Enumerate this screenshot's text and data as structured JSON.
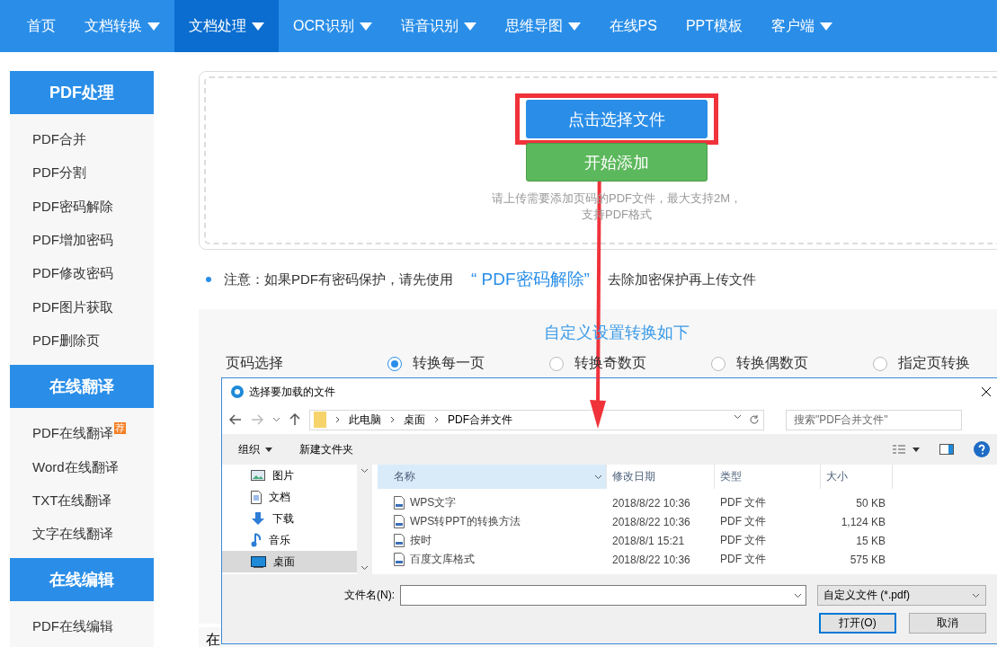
{
  "nav": [
    {
      "label": "首页",
      "dropdown": false,
      "selected": false
    },
    {
      "label": "文档转换",
      "dropdown": true,
      "selected": false
    },
    {
      "label": "文档处理",
      "dropdown": true,
      "selected": true
    },
    {
      "label": "OCR识别",
      "dropdown": true,
      "selected": false
    },
    {
      "label": "语音识别",
      "dropdown": true,
      "selected": false
    },
    {
      "label": "思维导图",
      "dropdown": true,
      "selected": false
    },
    {
      "label": "在线PS",
      "dropdown": false,
      "selected": false
    },
    {
      "label": "PPT模板",
      "dropdown": false,
      "selected": false
    },
    {
      "label": "客户端",
      "dropdown": true,
      "selected": false
    }
  ],
  "sidebar": {
    "groups": [
      {
        "title": "PDF处理",
        "items": [
          {
            "label": "PDF合并"
          },
          {
            "label": "PDF分割"
          },
          {
            "label": "PDF密码解除"
          },
          {
            "label": "PDF增加密码"
          },
          {
            "label": "PDF修改密码"
          },
          {
            "label": "PDF图片获取"
          },
          {
            "label": "PDF删除页"
          }
        ]
      },
      {
        "title": "在线翻译",
        "items": [
          {
            "label": "PDF在线翻译",
            "badge": "荐"
          },
          {
            "label": "Word在线翻译"
          },
          {
            "label": "TXT在线翻译"
          },
          {
            "label": "文字在线翻译"
          }
        ]
      },
      {
        "title": "在线编辑",
        "items": [
          {
            "label": "PDF在线编辑"
          }
        ]
      }
    ]
  },
  "upload": {
    "select_button": "点击选择文件",
    "start_button": "开始添加",
    "hint_lines": [
      "请上传需要添加页码的PDF文件，最大支持2M，",
      "支持PDF格式"
    ]
  },
  "note": {
    "prefix": "注意：如果PDF有密码保护，请先使用",
    "link": "“ PDF密码解除”",
    "suffix": "去除加密保护再上传文件"
  },
  "settings": {
    "title": "自定义设置转换如下",
    "label": "页码选择",
    "options": [
      {
        "label": "转换每一页",
        "selected": true
      },
      {
        "label": "转换奇数页",
        "selected": false
      },
      {
        "label": "转换偶数页",
        "selected": false
      },
      {
        "label": "指定页转换",
        "selected": false
      }
    ]
  },
  "bottom_text": "在",
  "dialog": {
    "title": "选择要加载的文件",
    "breadcrumb": [
      "此电脑",
      "桌面",
      "PDF合并文件"
    ],
    "search_placeholder": "搜索\"PDF合并文件\"",
    "toolbar": {
      "organize": "组织",
      "new_folder": "新建文件夹"
    },
    "nav_items": [
      {
        "label": "图片",
        "selected": false
      },
      {
        "label": "文档",
        "selected": false
      },
      {
        "label": "下载",
        "selected": false
      },
      {
        "label": "音乐",
        "selected": false
      },
      {
        "label": "桌面",
        "selected": true
      }
    ],
    "columns": [
      "名称",
      "修改日期",
      "类型",
      "大小"
    ],
    "files": [
      {
        "name": "WPS文字",
        "date": "2018/8/22 10:36",
        "type": "PDF 文件",
        "size": "50 KB"
      },
      {
        "name": "WPS转PPT的转换方法",
        "date": "2018/8/22 10:36",
        "type": "PDF 文件",
        "size": "1,124 KB"
      },
      {
        "name": "按时",
        "date": "2018/8/1 15:21",
        "type": "PDF 文件",
        "size": "15 KB"
      },
      {
        "name": "百度文库格式",
        "date": "2018/8/22 10:36",
        "type": "PDF 文件",
        "size": "575 KB"
      }
    ],
    "filename_label": "文件名(N):",
    "filter": "自定义文件 (*.pdf)",
    "open_button": "打开(O)",
    "cancel_button": "取消"
  }
}
